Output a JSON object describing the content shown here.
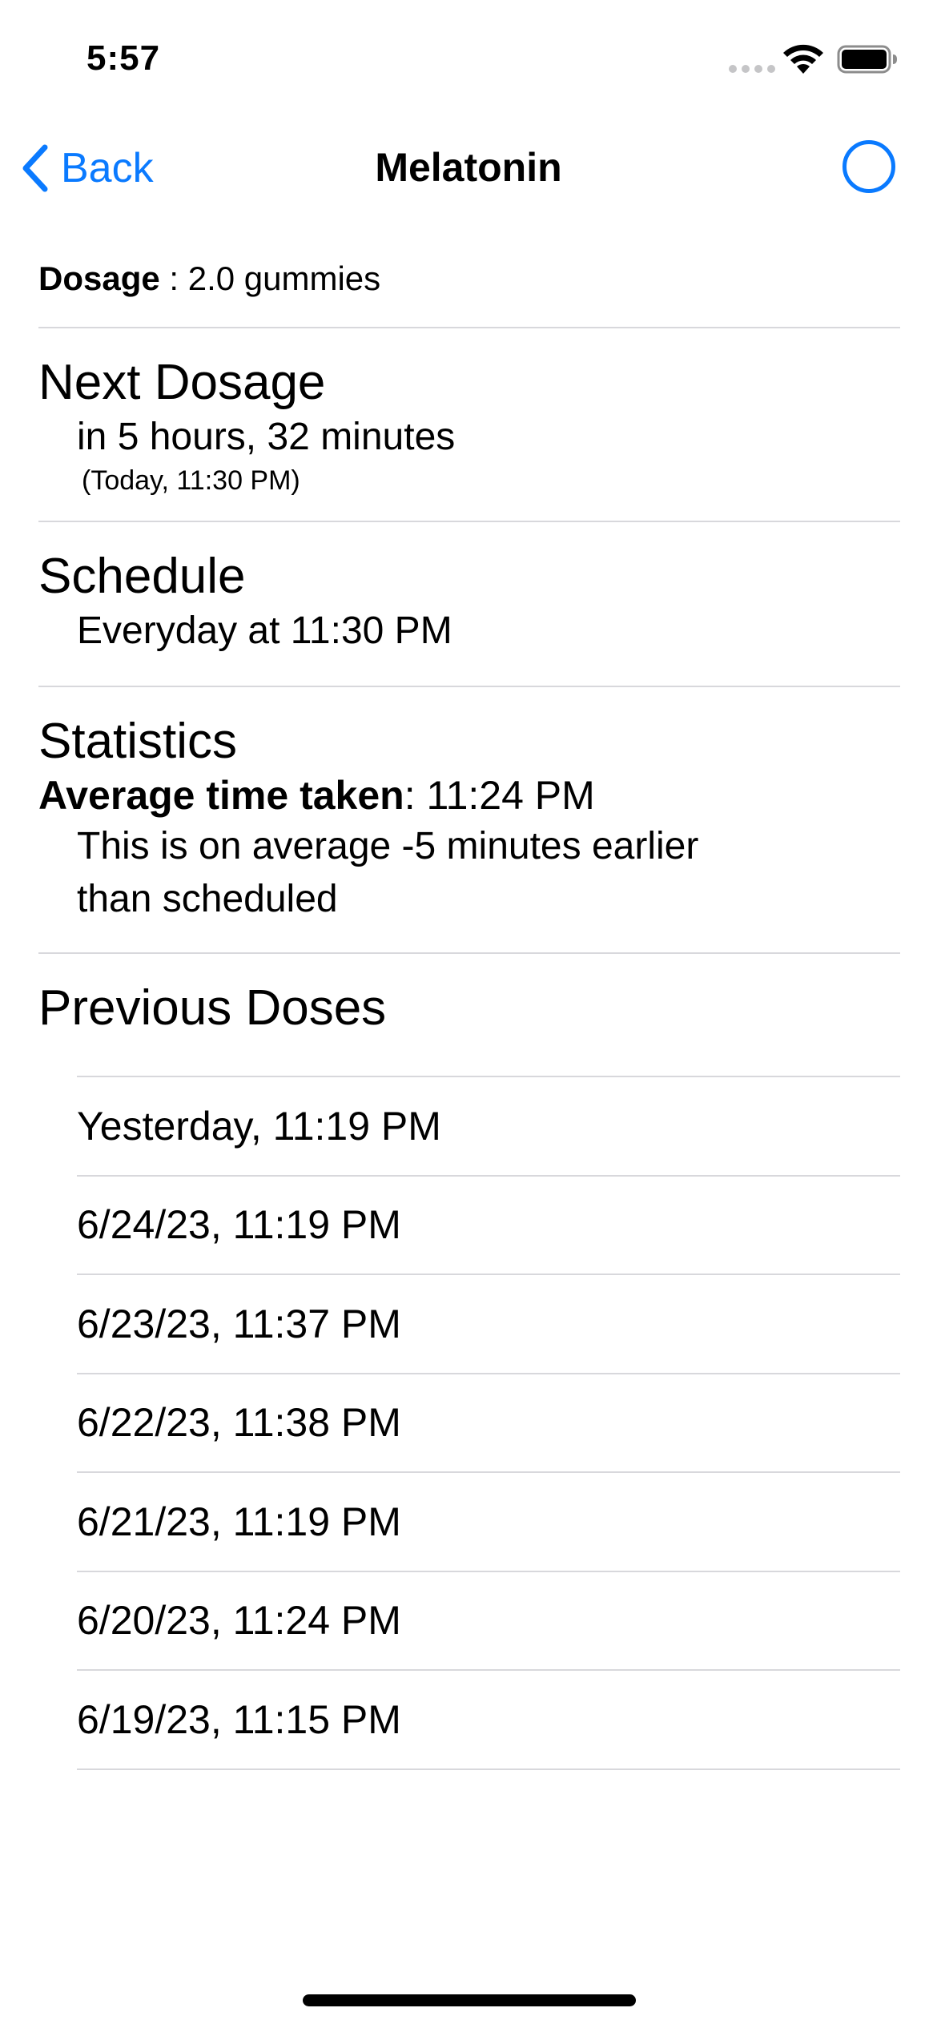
{
  "status_bar": {
    "time": "5:57",
    "icons": [
      "cellular-dots-icon",
      "wifi-icon",
      "battery-icon"
    ]
  },
  "nav": {
    "back_label": "Back",
    "title": "Melatonin",
    "right_icon": "circle-icon",
    "accent_color": "#0a7aff"
  },
  "dosage": {
    "label": "Dosage",
    "separator": " : ",
    "value": "2.0 gummies"
  },
  "next_dosage": {
    "title": "Next Dosage",
    "relative": "in 5 hours, 32 minutes",
    "absolute": "(Today, 11:30 PM)"
  },
  "schedule": {
    "title": "Schedule",
    "text": "Everyday at 11:30 PM"
  },
  "statistics": {
    "title": "Statistics",
    "avg_label": "Average time taken",
    "avg_value": ": 11:24 PM",
    "description": "This is on average  -5 minutes earlier than scheduled"
  },
  "previous_doses": {
    "title": "Previous Doses",
    "items": [
      "Yesterday, 11:19 PM",
      "6/24/23, 11:19 PM",
      "6/23/23, 11:37 PM",
      "6/22/23, 11:38 PM",
      "6/21/23, 11:19 PM",
      "6/20/23, 11:24 PM",
      "6/19/23, 11:15 PM"
    ]
  }
}
